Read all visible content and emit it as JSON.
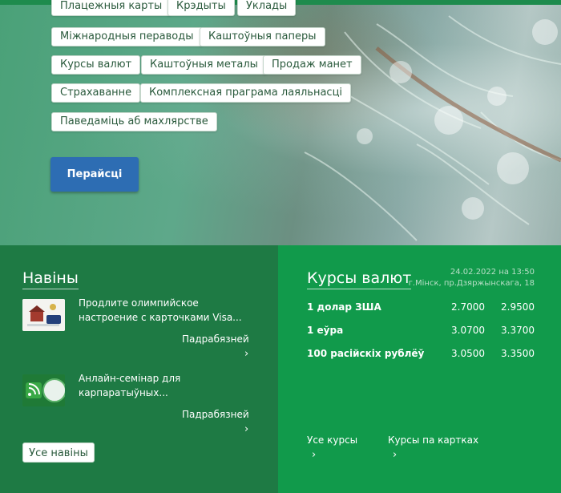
{
  "hero": {
    "chips": [
      "Плацежныя карты",
      "Крэдыты",
      "Уклады",
      "Міжнародныя пераводы",
      "Каштоўныя паперы",
      "Курсы валют",
      "Каштоўныя металы",
      "Продаж манет",
      "Страхаванне",
      "Комплексная праграма лаяльнасці",
      "Паведаміць аб махлярстве"
    ],
    "go_label": "Перайсці"
  },
  "news": {
    "title": "Навіны",
    "items": [
      {
        "text": "Продлите олимпийское настроение с карточками Visa...",
        "more": "Падрабязней",
        "chevron": "›",
        "icon": "olympic-visa-thumbnail"
      },
      {
        "text": "Анлайн-семінар для карпаратыўных...",
        "more": "Падрабязней",
        "chevron": "›",
        "icon": "rss-globe-thumbnail"
      }
    ],
    "all_label": "Усе навіны"
  },
  "rates": {
    "title": "Курсы валют",
    "date": "24.02.2022 на 13:50",
    "place": "г.Мінск, пр.Дзяржынскага, 18",
    "rows": [
      {
        "name": "1 долар ЗША",
        "buy": "2.7000",
        "sell": "2.9500"
      },
      {
        "name": "1 еўра",
        "buy": "3.0700",
        "sell": "3.3700"
      },
      {
        "name": "100 расійскіх рублёў",
        "buy": "3.0500",
        "sell": "3.3500"
      }
    ],
    "links": [
      {
        "label": "Усе курсы",
        "chevron": "›"
      },
      {
        "label": "Курсы па картках",
        "chevron": "›"
      }
    ]
  }
}
